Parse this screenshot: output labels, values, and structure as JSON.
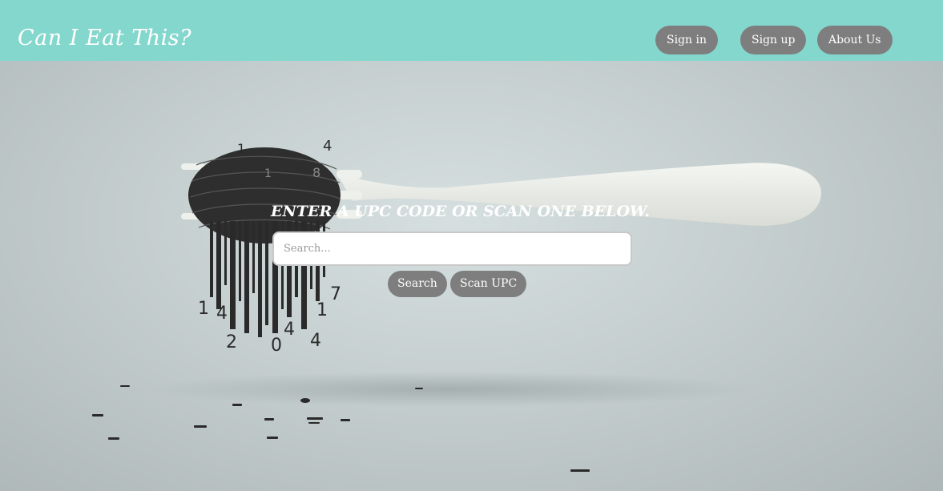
{
  "header": {
    "brand": "Can I Eat This?",
    "nav": {
      "sign_in": "Sign in",
      "sign_up": "Sign up",
      "about_us": "About Us"
    }
  },
  "main": {
    "heading": "Enter a UPC code or scan one below.",
    "search": {
      "value": "",
      "placeholder": "Search..."
    },
    "search_button": "Search",
    "scan_button": "Scan UPC"
  },
  "hero": {
    "digits": [
      "1",
      "4",
      "1",
      "8",
      "1",
      "4",
      "2",
      "0",
      "4",
      "4",
      "1",
      "7"
    ]
  },
  "colors": {
    "header_bg": "#84d7cd",
    "button_bg": "#7e7e7e",
    "button_text": "#ffffff"
  }
}
